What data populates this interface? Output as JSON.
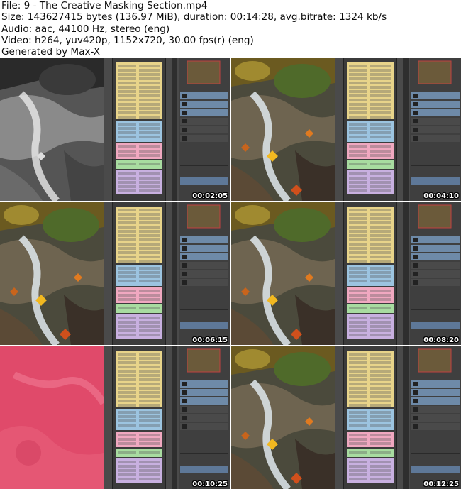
{
  "header": {
    "line1": "File: 9 - The Creative Masking Section.mp4",
    "line2": "Size: 143627415 bytes (136.97 MiB), duration: 00:14:28, avg.bitrate: 1324 kb/s",
    "line3": "Audio: aac, 44100 Hz, stereo (eng)",
    "line4": "Video: h264, yuv420p, 1152x720, 30.00 fps(r) (eng)",
    "line5": "Generated by Max-X"
  },
  "thumbnails": [
    {
      "timestamp": "00:02:05",
      "photo": "bw"
    },
    {
      "timestamp": "00:04:10",
      "photo": "color"
    },
    {
      "timestamp": "00:06:15",
      "photo": "color"
    },
    {
      "timestamp": "00:08:20",
      "photo": "color"
    },
    {
      "timestamp": "00:10:25",
      "photo": "red-mask"
    },
    {
      "timestamp": "00:12:25",
      "photo": "color"
    }
  ],
  "colors": {
    "panel_yellow": "#e8d48a",
    "panel_blue": "#9cc4e0",
    "panel_pink": "#f0a8c0",
    "panel_green": "#a8dca0",
    "panel_purple": "#c8b0e0",
    "mask_red": "#e04a6a"
  }
}
